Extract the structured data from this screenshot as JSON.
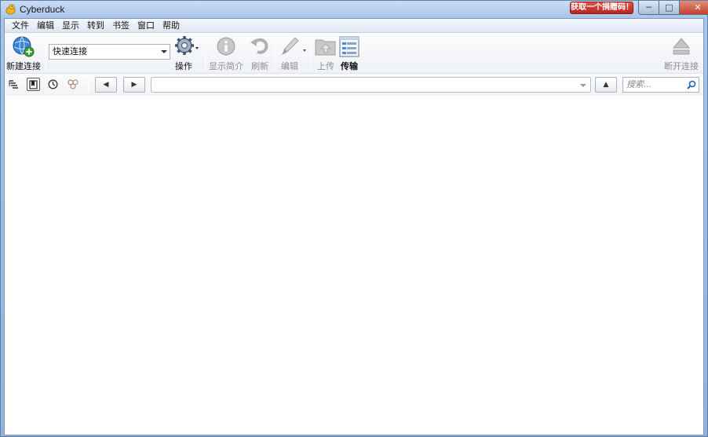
{
  "window": {
    "title": "Cyberduck",
    "donate_label": "获取一个捐赠码！",
    "min_label": "─",
    "max_label": "□",
    "close_label": "✕"
  },
  "menubar": {
    "items": [
      "文件",
      "编辑",
      "显示",
      "转到",
      "书签",
      "窗口",
      "帮助"
    ]
  },
  "toolbar": {
    "new_connection": "新建连接",
    "quick_connect": "快速连接",
    "action": "操作",
    "info": "显示简介",
    "refresh": "刷新",
    "edit": "编辑",
    "upload": "上传",
    "transfers": "传输",
    "disconnect": "断开连接"
  },
  "navbar": {
    "back": "◀",
    "forward": "▶",
    "up": "▲",
    "path_value": "",
    "search_placeholder": "搜索..."
  },
  "colors": {
    "title_gradient_top": "#c9dcf3",
    "donate_red": "#c8352a",
    "close_red": "#c5422c"
  }
}
